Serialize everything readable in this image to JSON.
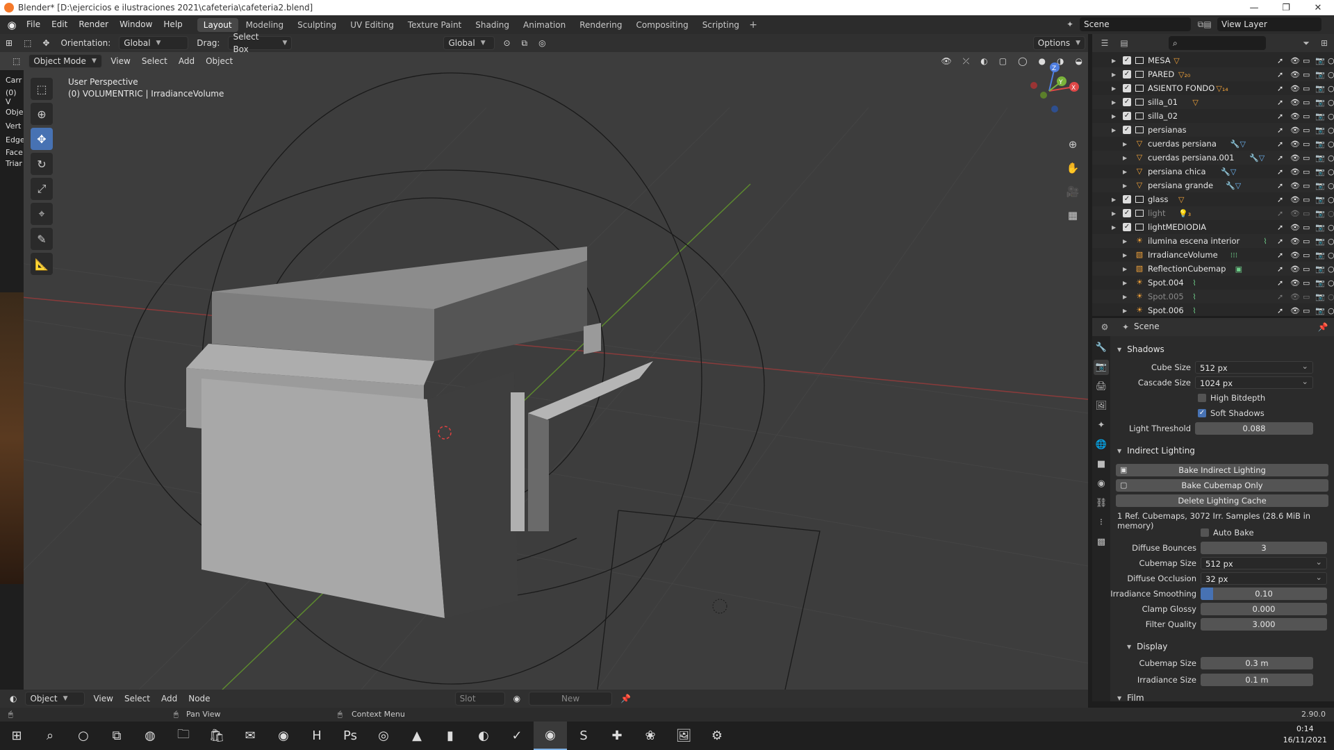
{
  "window": {
    "title": "Blender* [D:\\ejercicios e ilustraciones 2021\\cafeteria\\cafeteria2.blend]",
    "controls": [
      "—",
      "❐",
      "✕"
    ]
  },
  "menubar": {
    "menus": [
      "File",
      "Edit",
      "Render",
      "Window",
      "Help"
    ],
    "workspaces": [
      "Layout",
      "Modeling",
      "Sculpting",
      "UV Editing",
      "Texture Paint",
      "Shading",
      "Animation",
      "Rendering",
      "Compositing",
      "Scripting"
    ],
    "active_workspace": "Layout",
    "add_label": "+",
    "scene": "Scene",
    "view_layer": "View Layer"
  },
  "viewport_header": {
    "orientation_label": "Orientation:",
    "orientation_value": "Global",
    "drag_label": "Drag:",
    "drag_value": "Select Box",
    "transform_value": "Global",
    "options_label": "Options"
  },
  "viewport_header2": {
    "mode": "Object Mode",
    "menus": [
      "View",
      "Select",
      "Add",
      "Object"
    ]
  },
  "viewport": {
    "line1": "User Perspective",
    "line2": "(0) VOLUMENTRIC | IrradianceVolume",
    "gizmo": {
      "x": "X",
      "y": "Y",
      "z": "Z"
    }
  },
  "left_strip": {
    "labels": [
      "Carr",
      "(0) V",
      "Obje",
      "Vert",
      "Edge",
      "Face",
      "Triar"
    ]
  },
  "toolbar": {
    "tools": [
      "select-box",
      "cursor",
      "move",
      "rotate",
      "scale",
      "transform",
      "annotate",
      "measure"
    ]
  },
  "outliner": {
    "rows": [
      {
        "name": "MESA",
        "kind": "collection",
        "badge": "▽",
        "extra_color": "#f2a33a"
      },
      {
        "name": "PARED",
        "kind": "collection",
        "badge": "▽₂₀",
        "extra_color": "#f2a33a"
      },
      {
        "name": "ASIENTO FONDO",
        "kind": "collection",
        "badge": "▽₁₄",
        "extra_color": "#f2a33a"
      },
      {
        "name": "silla_01",
        "kind": "collection",
        "badge": "▽",
        "extra_color": "#f2a33a"
      },
      {
        "name": "silla_02",
        "kind": "collection",
        "badge": "",
        "extra_color": "#f2a33a"
      },
      {
        "name": "persianas",
        "kind": "collection",
        "badge": "",
        "extra_color": "#f2a33a"
      },
      {
        "name": "cuerdas persiana",
        "kind": "mesh",
        "badge": "🔧▽",
        "extra_color": "#6db3f2"
      },
      {
        "name": "cuerdas persiana.001",
        "kind": "mesh",
        "badge": "🔧▽",
        "extra_color": "#6db3f2"
      },
      {
        "name": "persiana chica",
        "kind": "mesh",
        "badge": "🔧▽",
        "extra_color": "#6db3f2"
      },
      {
        "name": "persiana grande",
        "kind": "mesh",
        "badge": "🔧▽",
        "extra_color": "#6db3f2"
      },
      {
        "name": "glass",
        "kind": "collection",
        "badge": "▽",
        "extra_color": "#f2a33a"
      },
      {
        "name": "light",
        "kind": "collection-dim",
        "badge": "💡₃",
        "extra_color": "#f2a33a"
      },
      {
        "name": "lightMEDIODIA",
        "kind": "collection",
        "badge": "",
        "extra_color": "#f2a33a"
      },
      {
        "name": "ilumina escena interior",
        "kind": "light",
        "badge": "⌇",
        "extra_color": "#6fcf8a"
      },
      {
        "name": "IrradianceVolume",
        "kind": "probe",
        "badge": "⁝⁝⁝",
        "extra_color": "#6fcf8a"
      },
      {
        "name": "ReflectionCubemap",
        "kind": "probe",
        "badge": "▣",
        "extra_color": "#6fcf8a"
      },
      {
        "name": "Spot.004",
        "kind": "light",
        "badge": "⌇",
        "extra_color": "#6fcf8a"
      },
      {
        "name": "Spot.005",
        "kind": "light-dim",
        "badge": "⌇",
        "extra_color": "#6fcf8a"
      },
      {
        "name": "Spot.006",
        "kind": "light",
        "badge": "⌇",
        "extra_color": "#6fcf8a"
      }
    ]
  },
  "properties": {
    "context": "Scene",
    "shadows": {
      "title": "Shadows",
      "cube_size_label": "Cube Size",
      "cube_size": "512 px",
      "cascade_size_label": "Cascade Size",
      "cascade_size": "1024 px",
      "high_bitdepth_label": "High Bitdepth",
      "high_bitdepth": false,
      "soft_shadows_label": "Soft Shadows",
      "soft_shadows": true,
      "light_threshold_label": "Light Threshold",
      "light_threshold": "0.088"
    },
    "indirect": {
      "title": "Indirect Lighting",
      "bake_indirect": "Bake Indirect Lighting",
      "bake_cubemap": "Bake Cubemap Only",
      "delete_cache": "Delete Lighting Cache",
      "info": "1 Ref. Cubemaps, 3072 Irr. Samples (28.6 MiB in memory)",
      "auto_bake_label": "Auto Bake",
      "auto_bake": false,
      "diffuse_bounces_label": "Diffuse Bounces",
      "diffuse_bounces": "3",
      "cubemap_size_label": "Cubemap Size",
      "cubemap_size": "512 px",
      "diffuse_occlusion_label": "Diffuse Occlusion",
      "diffuse_occlusion": "32 px",
      "irradiance_smoothing_label": "Irradiance Smoothing",
      "irradiance_smoothing": "0.10",
      "irradiance_smoothing_fraction": 0.1,
      "clamp_glossy_label": "Clamp Glossy",
      "clamp_glossy": "0.000",
      "filter_quality_label": "Filter Quality",
      "filter_quality": "3.000"
    },
    "display": {
      "title": "Display",
      "cubemap_size_label": "Cubemap Size",
      "cubemap_size": "0.3 m",
      "irradiance_size_label": "Irradiance Size",
      "irradiance_size": "0.1 m"
    },
    "film": {
      "title": "Film"
    }
  },
  "bottom_header": {
    "mode": "Object",
    "menus": [
      "View",
      "Select",
      "Add",
      "Node"
    ],
    "slot_label": "Slot",
    "new_label": "New"
  },
  "statusbar": {
    "pan_view": "Pan View",
    "context_menu": "Context Menu",
    "version": "2.90.0"
  },
  "taskbar": {
    "time": "0:14",
    "date": "16/11/2021"
  },
  "colors": {
    "accent": "#4772b3",
    "object_orange": "#f2a33a",
    "data_green": "#6fcf8a",
    "axis_red": "#c84848",
    "axis_green": "#7ab33a"
  }
}
